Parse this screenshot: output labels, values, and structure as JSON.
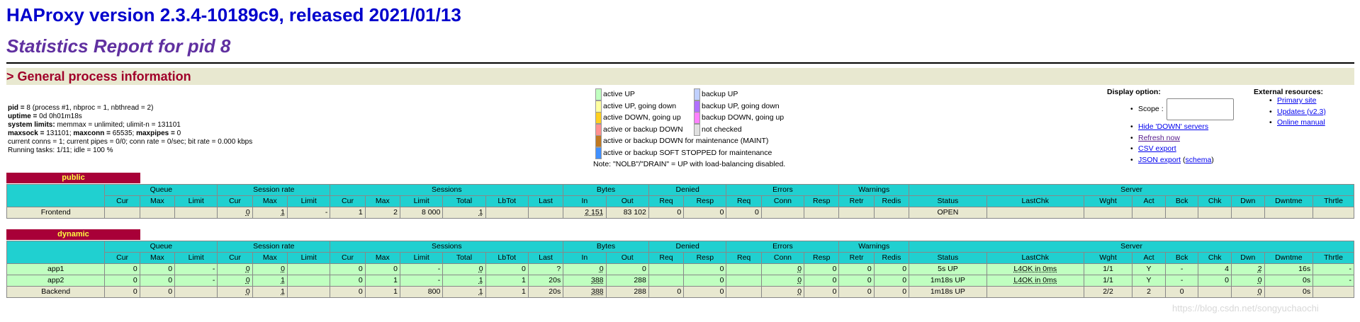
{
  "header": {
    "title": "HAProxy version 2.3.4-10189c9, released 2021/01/13",
    "subtitle": "Statistics Report for pid 8"
  },
  "section": {
    "title": "> General process information"
  },
  "process": {
    "pid_label": "pid =",
    "pid_value": " 8 (process #1, nbproc = 1, nbthread = 2)",
    "uptime_label": "uptime =",
    "uptime_value": " 0d 0h01m18s",
    "limits_label": "system limits:",
    "limits_value": " memmax = unlimited; ulimit-n = 131101",
    "maxsock_label": "maxsock =",
    "maxsock_value": " 131101; ",
    "maxconn_label": "maxconn =",
    "maxconn_value": " 65535; ",
    "maxpipes_label": "maxpipes =",
    "maxpipes_value": " 0",
    "conns_line": "current conns = 1; current pipes = 0/0; conn rate = 0/sec; bit rate = 0.000 kbps",
    "tasks_line": "Running tasks: 1/11; idle = 100 %"
  },
  "legend": {
    "items": [
      {
        "label": "active UP",
        "color": "#c0ffc0"
      },
      {
        "label": "active UP, going down",
        "color": "#ffffa0"
      },
      {
        "label": "active DOWN, going up",
        "color": "#ffd020"
      },
      {
        "label": "active or backup DOWN",
        "color": "#ff9090"
      },
      {
        "label": "active or backup DOWN for maintenance (MAINT)",
        "color": "#c07820"
      },
      {
        "label": "active or backup SOFT STOPPED for maintenance",
        "color": "#4090ff"
      },
      {
        "label": "backup UP",
        "color": "#c0d0ff"
      },
      {
        "label": "backup UP, going down",
        "color": "#b070ff"
      },
      {
        "label": "backup DOWN, going up",
        "color": "#ff80ff"
      },
      {
        "label": "not checked",
        "color": "#e0e0e0"
      }
    ],
    "note": "Note: \"NOLB\"/\"DRAIN\" = UP with load-balancing disabled."
  },
  "display": {
    "title": "Display option:",
    "scope_label": "Scope :",
    "hide_down": "Hide 'DOWN' servers",
    "refresh": "Refresh now",
    "csv": "CSV export",
    "json": "JSON export",
    "schema_open": " (",
    "schema": "schema",
    "schema_close": ")"
  },
  "external": {
    "title": "External resources:",
    "primary": "Primary site",
    "updates": "Updates (v2.3)",
    "manual": "Online manual"
  },
  "groups": [
    "Queue",
    "Session rate",
    "Sessions",
    "Bytes",
    "Denied",
    "Errors",
    "Warnings",
    "Server"
  ],
  "columns": {
    "queue": [
      "Cur",
      "Max",
      "Limit"
    ],
    "rate": [
      "Cur",
      "Max",
      "Limit"
    ],
    "sessions": [
      "Cur",
      "Max",
      "Limit",
      "Total",
      "LbTot",
      "Last"
    ],
    "bytes": [
      "In",
      "Out"
    ],
    "denied": [
      "Req",
      "Resp"
    ],
    "errors": [
      "Req",
      "Conn",
      "Resp"
    ],
    "warnings": [
      "Retr",
      "Redis"
    ],
    "server": [
      "Status",
      "LastChk",
      "Wght",
      "Act",
      "Bck",
      "Chk",
      "Dwn",
      "Dwntme",
      "Thrtle"
    ]
  },
  "public": {
    "name": "public",
    "frontend": [
      "Frontend",
      "",
      "",
      "",
      "0",
      "1",
      "-",
      "1",
      "2",
      "8 000",
      "1",
      "",
      "",
      "2 151",
      "83 102",
      "0",
      "0",
      "0",
      "",
      "",
      "",
      "",
      "OPEN",
      "",
      "",
      "",
      "",
      "",
      "",
      "",
      ""
    ]
  },
  "dynamic": {
    "name": "dynamic",
    "rows": [
      [
        "app1",
        "0",
        "0",
        "-",
        "0",
        "0",
        "",
        "0",
        "0",
        "-",
        "0",
        "0",
        "?",
        "0",
        "0",
        "",
        "0",
        "",
        "0",
        "0",
        "0",
        "0",
        "5s UP",
        "L4OK in 0ms",
        "1/1",
        "Y",
        "-",
        "4",
        "2",
        "16s",
        "-"
      ],
      [
        "app2",
        "0",
        "0",
        "-",
        "0",
        "1",
        "",
        "0",
        "1",
        "-",
        "1",
        "1",
        "20s",
        "388",
        "288",
        "",
        "0",
        "",
        "0",
        "0",
        "0",
        "0",
        "1m18s UP",
        "L4OK in 0ms",
        "1/1",
        "Y",
        "-",
        "0",
        "0",
        "0s",
        "-"
      ],
      [
        "Backend",
        "0",
        "0",
        "",
        "0",
        "1",
        "",
        "0",
        "1",
        "800",
        "1",
        "1",
        "20s",
        "388",
        "288",
        "0",
        "0",
        "",
        "0",
        "0",
        "0",
        "0",
        "1m18s UP",
        "",
        "2/2",
        "2",
        "0",
        "",
        "0",
        "0s",
        ""
      ]
    ]
  },
  "watermark": "https://blog.csdn.net/songyuchaochi"
}
